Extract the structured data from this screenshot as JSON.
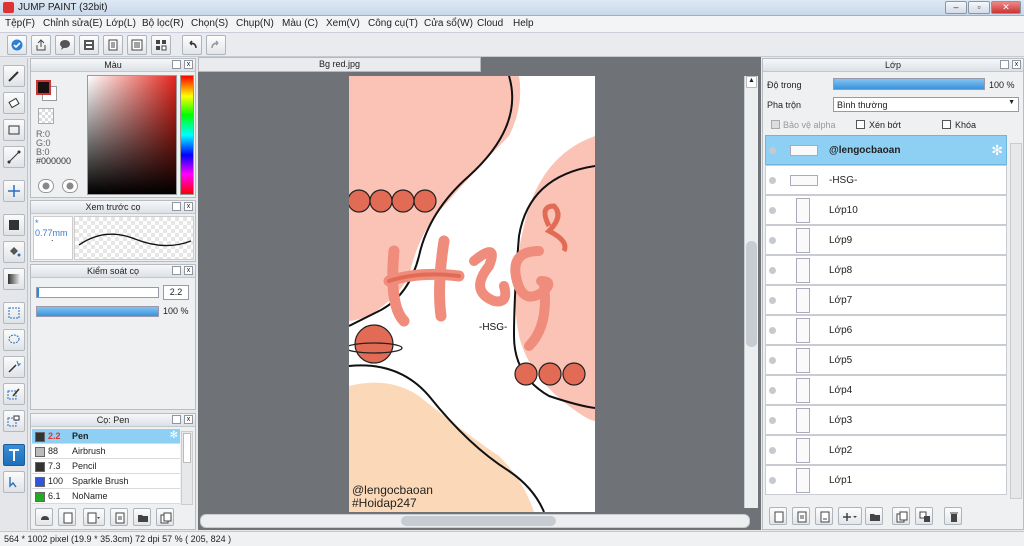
{
  "window": {
    "title": "JUMP PAINT (32bit)"
  },
  "menu": [
    "Tệp(F)",
    "Chỉnh sửa(E)",
    "Lớp(L)",
    "Bộ lọc(R)",
    "Chọn(S)",
    "Chụp(N)",
    "Màu (C)",
    "Xem(V)",
    "Công cụ(T)",
    "Cửa sổ(W)",
    "Cloud",
    "Help"
  ],
  "color_panel": {
    "title": "Màu",
    "r": "R:0",
    "g": "G:0",
    "b": "B:0",
    "hex": "#000000",
    "fg": "#1a1010",
    "bg": "#ffffff"
  },
  "brush_preview": {
    "title": "Xem trước cọ",
    "size": "* 0.77mm",
    "dot": "."
  },
  "brush_control": {
    "title": "Kiểm soát cọ",
    "size_value": "2.2",
    "opacity_value": "100 %",
    "opacity_fraction": 1.0
  },
  "brush_list": {
    "title": "Cọ: Pen",
    "items": [
      {
        "size": "2.2",
        "name": "Pen",
        "color": "#333333",
        "selected": true
      },
      {
        "size": "88",
        "name": "Airbrush",
        "color": "#bbbbbb",
        "selected": false
      },
      {
        "size": "7.3",
        "name": "Pencil",
        "color": "#333333",
        "selected": false
      },
      {
        "size": "100",
        "name": "Sparkle Brush",
        "color": "#3355dd",
        "selected": false
      },
      {
        "size": "6.1",
        "name": "NoName",
        "color": "#22aa22",
        "selected": false
      }
    ]
  },
  "document": {
    "tab": "Bg red.jpg"
  },
  "artwork": {
    "title_text": "HSG",
    "small_text": "-HSG-",
    "handle": "@lengocbaoan",
    "hashtag": "#Hoidap247"
  },
  "layers_panel": {
    "title": "Lớp",
    "opacity_label": "Độ trong",
    "opacity_value": "100 %",
    "opacity_fraction": 1.0,
    "blend_label": "Pha trộn",
    "blend_value": "Bình thường",
    "protect_alpha": "Bảo vệ alpha",
    "clip": "Xén bớt",
    "lock": "Khóa",
    "layers": [
      {
        "name": "@lengocbaoan",
        "selected": true
      },
      {
        "name": "-HSG-",
        "selected": false
      },
      {
        "name": "Lớp10",
        "selected": false
      },
      {
        "name": "Lớp9",
        "selected": false
      },
      {
        "name": "Lớp8",
        "selected": false
      },
      {
        "name": "Lớp7",
        "selected": false
      },
      {
        "name": "Lớp6",
        "selected": false
      },
      {
        "name": "Lớp5",
        "selected": false
      },
      {
        "name": "Lớp4",
        "selected": false
      },
      {
        "name": "Lớp3",
        "selected": false
      },
      {
        "name": "Lớp2",
        "selected": false
      },
      {
        "name": "Lớp1",
        "selected": false
      }
    ]
  },
  "status": {
    "text": "564 * 1002 pixel   (19.9 * 35.3cm)   72 dpi   57 %   ( 205, 824 )"
  },
  "colors": {
    "accent": "#8ecff4",
    "peach": "#fbc3b5",
    "cream": "#fbd9b8",
    "coral": "#e76b57"
  }
}
